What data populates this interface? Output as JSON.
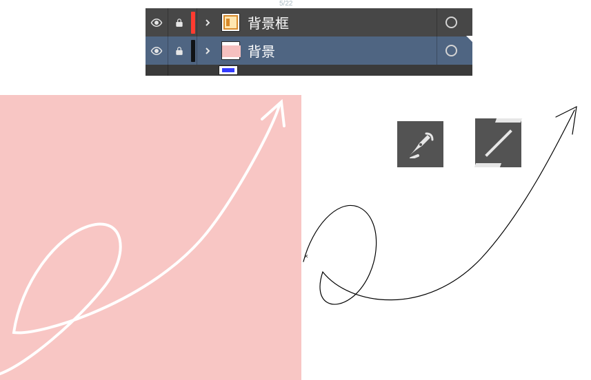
{
  "header_fragment": "5/22",
  "layers": [
    {
      "name": "背景框",
      "color": "#ff3b30",
      "selected": false
    },
    {
      "name": "背景",
      "color": "#101316",
      "selected": true
    }
  ],
  "tools": {
    "pen": {
      "name": "pen-tool"
    },
    "line": {
      "name": "line-tool"
    }
  },
  "canvas": {
    "fill": "#f8c6c4"
  }
}
